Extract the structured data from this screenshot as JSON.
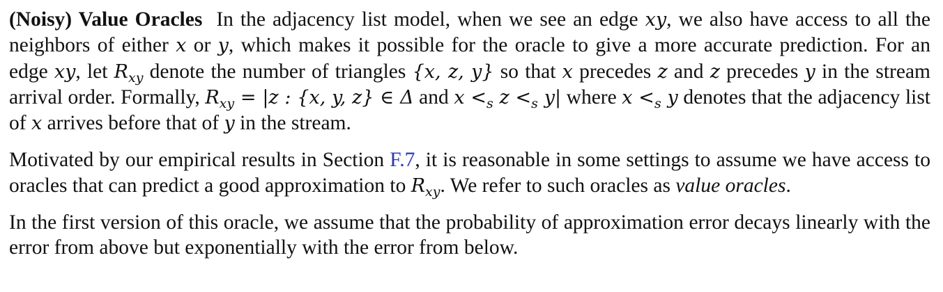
{
  "p1": {
    "heading": "(Noisy) Value Oracles",
    "t1": "In the adjacency list model, when we see an edge ",
    "m_xy": "xy",
    "t2": ", we also have access to all the neighbors of either ",
    "m_x": "x",
    "t3": " or ",
    "m_y": "y",
    "t4": ", which makes it possible for the oracle to give a more accurate prediction. For an edge ",
    "m_xy2": "xy",
    "t5": ", let ",
    "m_R": "R",
    "m_Rsub": "xy",
    "t6": " denote the number of triangles ",
    "m_triple": "{x, z, y}",
    "t7": " so that ",
    "m_x2": "x",
    "t8": " precedes ",
    "m_z": "z",
    "t9": " and ",
    "m_z2": "z",
    "t10": " precedes ",
    "m_y2": "y",
    "t11": " in the stream arrival order. Formally, ",
    "m_R2": "R",
    "m_R2sub": "xy",
    "m_eq": " = |z : {x, y, z} ∈ Δ",
    "t12": " and ",
    "m_order_a": "x <",
    "m_order_sub1": "s",
    "m_order_b": " z <",
    "m_order_sub2": "s",
    "m_order_c": " y|",
    "t13": " where ",
    "m_lt_a": "x <",
    "m_lt_sub": "s",
    "m_lt_b": " y",
    "t14": " denotes that the adjacency list of ",
    "m_x3": "x",
    "t15": " arrives before that of ",
    "m_y3": "y",
    "t16": " in the stream."
  },
  "p2": {
    "t1": "Motivated by our empirical results in Section ",
    "link": "F.7",
    "t2": ", it is reasonable in some settings to assume we have access to oracles that can predict a good approximation to ",
    "m_R": "R",
    "m_Rsub": "xy",
    "t3": ". We refer to such oracles as ",
    "em": "value oracles",
    "t4": "."
  },
  "p3": {
    "text": "In the first version of this oracle, we assume that the probability of approximation error decays linearly with the error from above but exponentially with the error from below."
  },
  "colors": {
    "text": "#111111",
    "link": "#2a34c8",
    "background": "#ffffff"
  }
}
